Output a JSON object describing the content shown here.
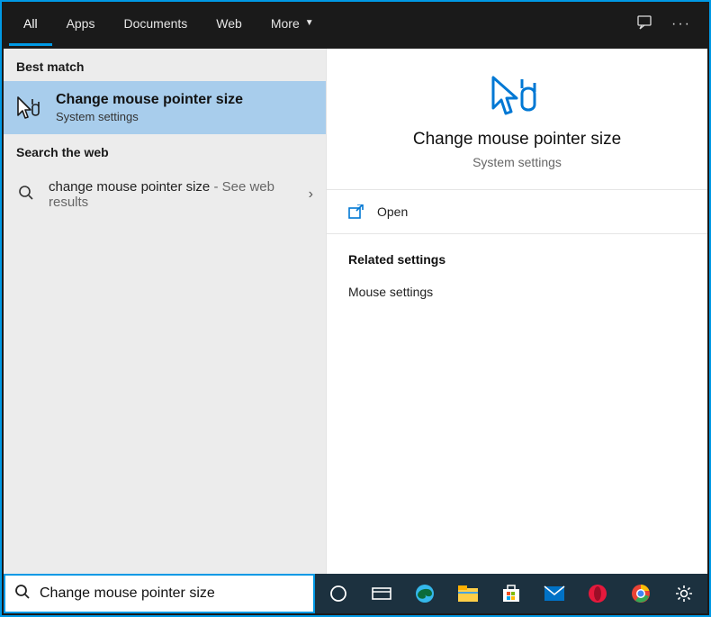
{
  "tabs": {
    "all": "All",
    "apps": "Apps",
    "documents": "Documents",
    "web": "Web",
    "more": "More"
  },
  "left": {
    "best_match_label": "Best match",
    "best_match": {
      "title": "Change mouse pointer size",
      "subtitle": "System settings"
    },
    "search_web_label": "Search the web",
    "web_result": {
      "query": "change mouse pointer size",
      "suffix": " - See web results"
    }
  },
  "preview": {
    "title": "Change mouse pointer size",
    "subtitle": "System settings",
    "open_label": "Open",
    "related_header": "Related settings",
    "related_link": "Mouse settings"
  },
  "search": {
    "value": "Change mouse pointer size"
  },
  "colors": {
    "accent": "#0099e5"
  }
}
